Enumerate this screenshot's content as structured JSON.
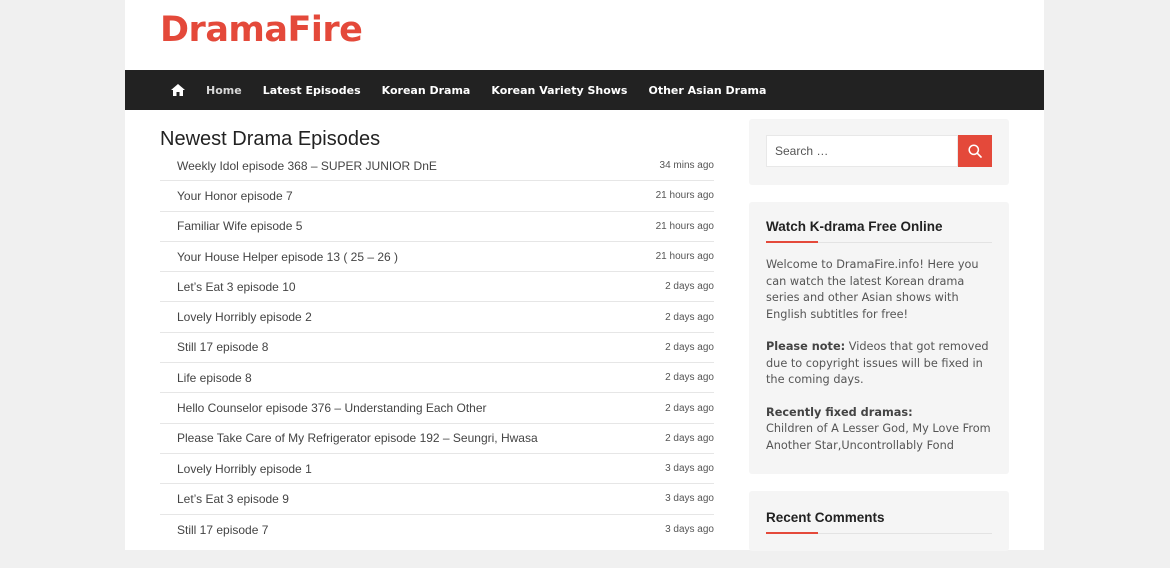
{
  "site": {
    "logo": "DramaFire"
  },
  "nav": {
    "items": [
      {
        "label": "Home",
        "active": true
      },
      {
        "label": "Latest Episodes"
      },
      {
        "label": "Korean Drama"
      },
      {
        "label": "Korean Variety Shows"
      },
      {
        "label": "Other Asian Drama"
      }
    ]
  },
  "main": {
    "title": "Newest Drama Episodes",
    "episodes": [
      {
        "title": "Weekly Idol episode 368 – SUPER JUNIOR DnE",
        "time": "34 mins ago"
      },
      {
        "title": "Your Honor episode 7",
        "time": "21 hours ago"
      },
      {
        "title": "Familiar Wife episode 5",
        "time": "21 hours ago"
      },
      {
        "title": "Your House Helper episode 13 ( 25 – 26 )",
        "time": "21 hours ago"
      },
      {
        "title": "Let’s Eat 3 episode 10",
        "time": "2 days ago"
      },
      {
        "title": "Lovely Horribly episode 2",
        "time": "2 days ago"
      },
      {
        "title": "Still 17 episode 8",
        "time": "2 days ago"
      },
      {
        "title": "Life episode 8",
        "time": "2 days ago"
      },
      {
        "title": "Hello Counselor episode 376 – Understanding Each Other",
        "time": "2 days ago"
      },
      {
        "title": "Please Take Care of My Refrigerator episode 192 – Seungri, Hwasa",
        "time": "2 days ago"
      },
      {
        "title": "Lovely Horribly episode 1",
        "time": "3 days ago"
      },
      {
        "title": "Let’s Eat 3 episode 9",
        "time": "3 days ago"
      },
      {
        "title": "Still 17 episode 7",
        "time": "3 days ago"
      }
    ]
  },
  "sidebar": {
    "search": {
      "placeholder": "Search …"
    },
    "info": {
      "title": "Watch K-drama Free Online",
      "welcome": "Welcome to DramaFire.info! Here you can watch the latest Korean drama series and other Asian shows with English subtitles for free!",
      "note_label": "Please note:",
      "note_text": " Videos that got removed due to copyright issues will be fixed in the coming days.",
      "fixed_label": "Recently fixed dramas:",
      "fixed_text": "Children of A Lesser God, My Love From Another Star,Uncontrollably Fond"
    },
    "comments": {
      "title": "Recent Comments"
    }
  },
  "colors": {
    "accent": "#e4493a",
    "nav_bg": "#222222"
  },
  "icons": {
    "home": "home-icon",
    "search": "search-icon"
  }
}
